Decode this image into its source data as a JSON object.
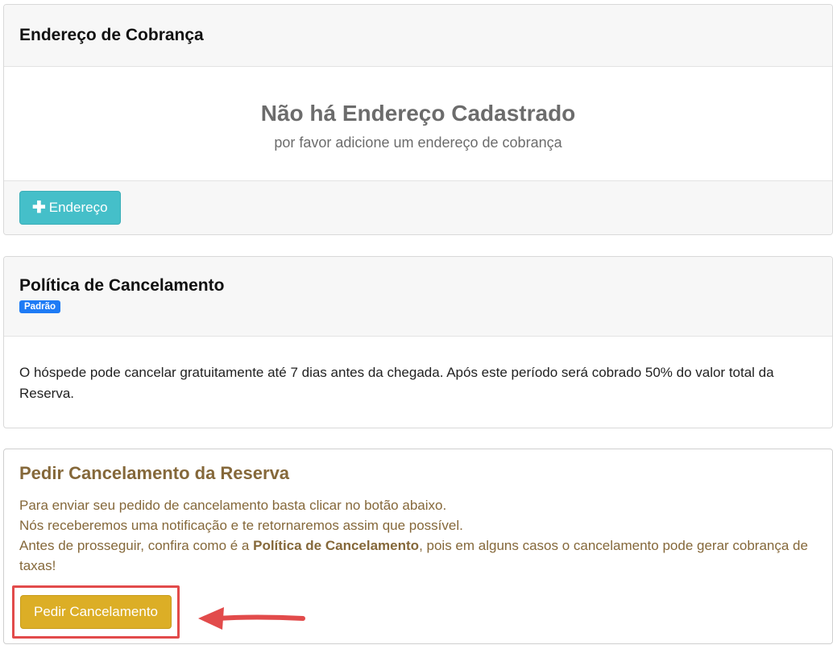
{
  "billing_card": {
    "title": "Endereço de Cobrança",
    "empty_title": "Não há Endereço Cadastrado",
    "empty_subtitle": "por favor adicione um endereço de cobrança",
    "add_button_label": "Endereço",
    "add_button_icon": "plus-icon"
  },
  "policy_card": {
    "title": "Política de Cancelamento",
    "badge": "Padrão",
    "description": "O hóspede pode cancelar gratuitamente até 7 dias antes da chegada. Após este período será cobrado 50% do valor total da Reserva."
  },
  "cancel_card": {
    "title": "Pedir Cancelamento da Reserva",
    "line1": "Para enviar seu pedido de cancelamento basta clicar no botão abaixo.",
    "line2": "Nós receberemos uma notificação e te retornaremos assim que possível.",
    "line3_prefix": "Antes de prosseguir, confira como é a ",
    "line3_bold": "Política de Cancelamento",
    "line3_suffix": ", pois em alguns casos o cancelamento pode gerar cobrança de taxas!",
    "button_label": "Pedir Cancelamento"
  },
  "colors": {
    "info_button": "#45bfc9",
    "warning_button": "#dcae26",
    "badge": "#1e7bf5",
    "cancel_text": "#85683a",
    "highlight": "#e24b4b"
  }
}
